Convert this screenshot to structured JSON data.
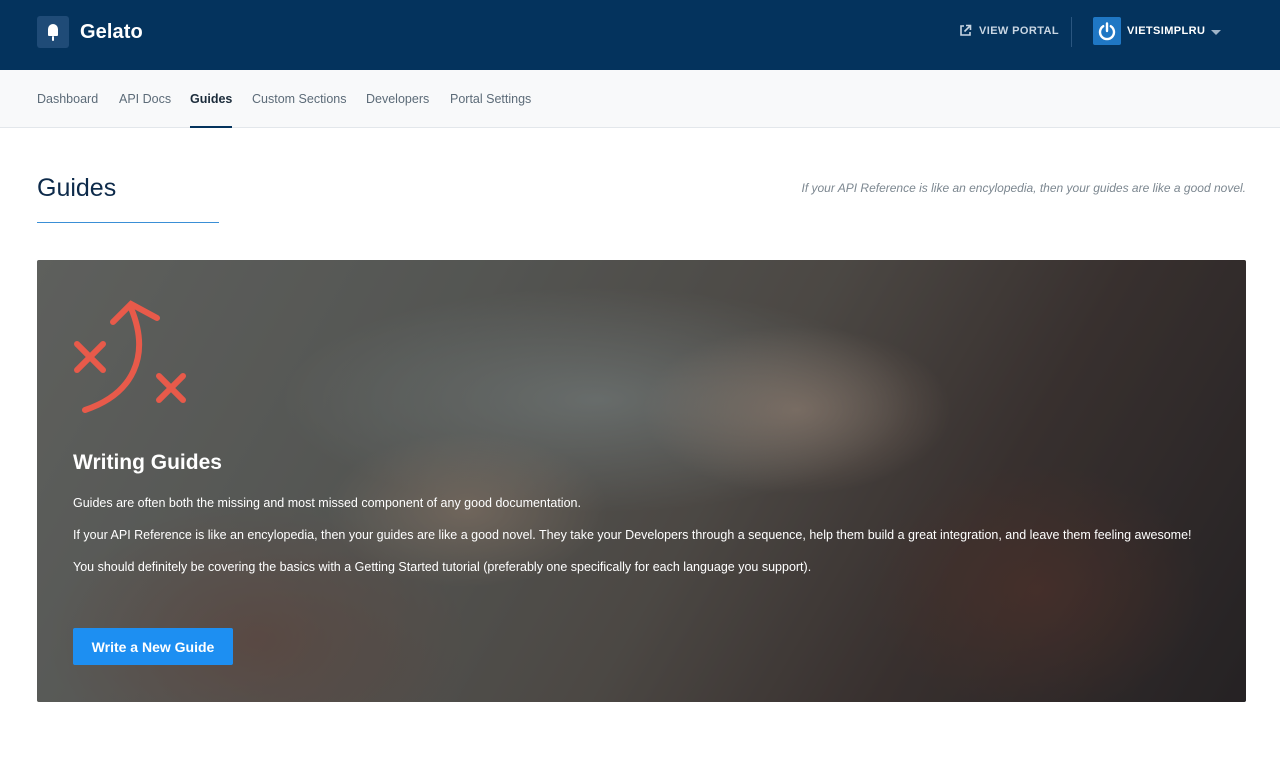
{
  "app": {
    "name": "Gelato",
    "logo_icon": "popsicle-icon",
    "view_portal_label": "VIEW PORTAL",
    "view_portal_icon": "external-link-icon",
    "user_name": "VIETSIMPLRU",
    "user_avatar_icon": "power-icon"
  },
  "nav": {
    "items": [
      {
        "label": "Dashboard"
      },
      {
        "label": "API Docs"
      },
      {
        "label": "Guides"
      },
      {
        "label": "Custom Sections"
      },
      {
        "label": "Developers"
      },
      {
        "label": "Portal Settings"
      }
    ],
    "active": "Guides"
  },
  "page": {
    "title": "Guides",
    "tagline": "If your API Reference is like an encylopedia, then your guides are like a good novel."
  },
  "hero": {
    "icon": "strategy-play-icon",
    "title": "Writing Guides",
    "paragraphs": [
      "Guides are often both the missing and most missed component of any good documentation.",
      "If your API Reference is like an encylopedia, then your guides are like a good novel. They take your Developers through a sequence, help them build a great integration, and leave them feeling awesome!",
      "You should definitely be covering the basics with a Getting Started tutorial (preferably one specifically for each language you support)."
    ],
    "cta_label": "Write a New Guide"
  },
  "colors": {
    "topbar": "#04335d",
    "accent": "#1d8ff2",
    "icon_red": "#e85a4a"
  }
}
